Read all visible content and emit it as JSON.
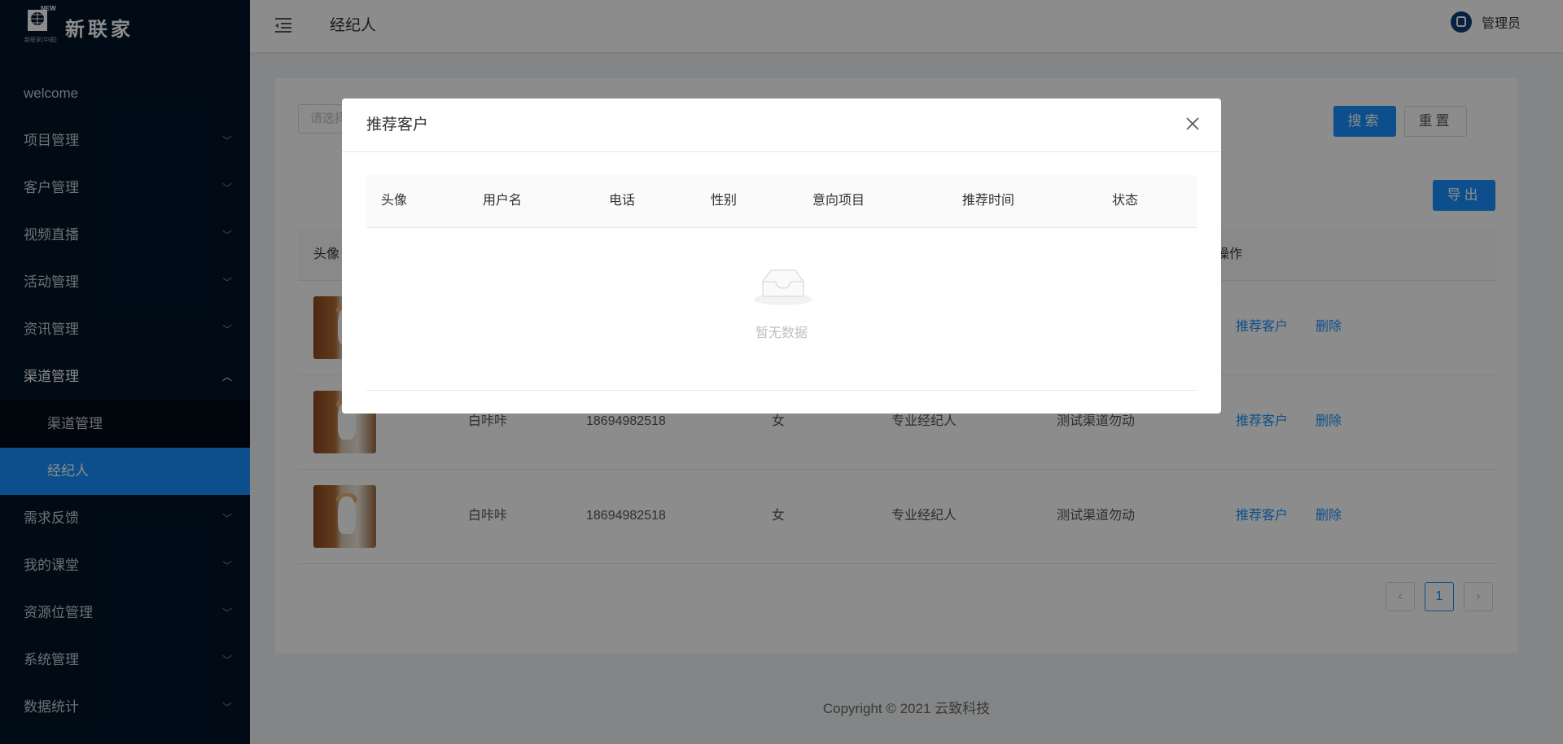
{
  "brand": {
    "name": "新联家",
    "sub_text": "新联家(中国)",
    "badge": "NEW"
  },
  "sidebar": {
    "items": [
      {
        "label": "welcome"
      },
      {
        "label": "项目管理"
      },
      {
        "label": "客户管理"
      },
      {
        "label": "视频直播"
      },
      {
        "label": "活动管理"
      },
      {
        "label": "资讯管理"
      },
      {
        "label": "渠道管理"
      },
      {
        "label": "需求反馈"
      },
      {
        "label": "我的课堂"
      },
      {
        "label": "资源位管理"
      },
      {
        "label": "系统管理"
      },
      {
        "label": "数据统计"
      }
    ],
    "sub_items": [
      {
        "label": "渠道管理"
      },
      {
        "label": "经纪人"
      }
    ]
  },
  "header": {
    "title": "经纪人",
    "user": "管理员"
  },
  "filter": {
    "placeholder": "请选择"
  },
  "buttons": {
    "search": "搜索",
    "reset": "重置",
    "export": "导出"
  },
  "table": {
    "headers": [
      "头像",
      "操作"
    ],
    "rows": [
      {
        "name": "",
        "phone": "",
        "gender": "",
        "type": "",
        "channel": "",
        "action1": "推荐客户",
        "action2": "删除"
      },
      {
        "name": "白咔咔",
        "phone": "18694982518",
        "gender": "女",
        "type": "专业经纪人",
        "channel": "测试渠道勿动",
        "action1": "推荐客户",
        "action2": "删除"
      },
      {
        "name": "白咔咔",
        "phone": "18694982518",
        "gender": "女",
        "type": "专业经纪人",
        "channel": "测试渠道勿动",
        "action1": "推荐客户",
        "action2": "删除"
      }
    ]
  },
  "pagination": {
    "current": "1",
    "prev": "‹",
    "next": "›"
  },
  "footer": {
    "text": "Copyright © 2021 云致科技"
  },
  "modal": {
    "title": "推荐客户",
    "close": "✕",
    "columns": [
      "头像",
      "用户名",
      "电话",
      "性别",
      "意向项目",
      "推荐时间",
      "状态"
    ],
    "empty_text": "暂无数据"
  },
  "colors": {
    "sidebar_bg": "#001529",
    "primary": "#1890ff",
    "overlay": "rgba(0,0,0,0.45)"
  }
}
